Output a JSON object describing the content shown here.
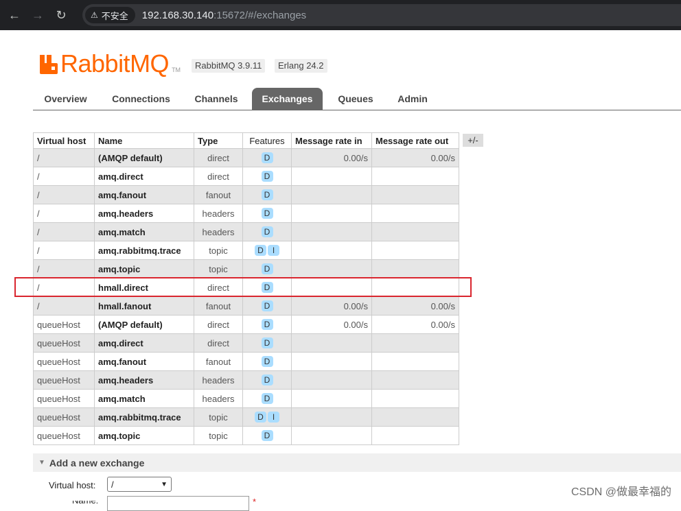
{
  "browser": {
    "security_label": "不安全",
    "url_host": "192.168.30.140",
    "url_rest": ":15672/#/exchanges"
  },
  "header": {
    "logo_text": "RabbitMQ",
    "logo_tm": "TM",
    "version": "RabbitMQ 3.9.11",
    "erlang": "Erlang 24.2",
    "brand_color": "#ff6600"
  },
  "tabs": [
    {
      "label": "Overview"
    },
    {
      "label": "Connections"
    },
    {
      "label": "Channels"
    },
    {
      "label": "Exchanges",
      "active": true
    },
    {
      "label": "Queues"
    },
    {
      "label": "Admin"
    }
  ],
  "table": {
    "columns": [
      "Virtual host",
      "Name",
      "Type",
      "Features",
      "Message rate in",
      "Message rate out"
    ],
    "toggle_label": "+/-",
    "rows": [
      {
        "vhost": "/",
        "name": "(AMQP default)",
        "type": "direct",
        "features": [
          "D"
        ],
        "rate_in": "0.00/s",
        "rate_out": "0.00/s"
      },
      {
        "vhost": "/",
        "name": "amq.direct",
        "type": "direct",
        "features": [
          "D"
        ],
        "rate_in": "",
        "rate_out": ""
      },
      {
        "vhost": "/",
        "name": "amq.fanout",
        "type": "fanout",
        "features": [
          "D"
        ],
        "rate_in": "",
        "rate_out": ""
      },
      {
        "vhost": "/",
        "name": "amq.headers",
        "type": "headers",
        "features": [
          "D"
        ],
        "rate_in": "",
        "rate_out": ""
      },
      {
        "vhost": "/",
        "name": "amq.match",
        "type": "headers",
        "features": [
          "D"
        ],
        "rate_in": "",
        "rate_out": ""
      },
      {
        "vhost": "/",
        "name": "amq.rabbitmq.trace",
        "type": "topic",
        "features": [
          "D",
          "I"
        ],
        "rate_in": "",
        "rate_out": ""
      },
      {
        "vhost": "/",
        "name": "amq.topic",
        "type": "topic",
        "features": [
          "D"
        ],
        "rate_in": "",
        "rate_out": ""
      },
      {
        "vhost": "/",
        "name": "hmall.direct",
        "type": "direct",
        "features": [
          "D"
        ],
        "rate_in": "",
        "rate_out": "",
        "highlighted": true
      },
      {
        "vhost": "/",
        "name": "hmall.fanout",
        "type": "fanout",
        "features": [
          "D"
        ],
        "rate_in": "0.00/s",
        "rate_out": "0.00/s"
      },
      {
        "vhost": "queueHost",
        "name": "(AMQP default)",
        "type": "direct",
        "features": [
          "D"
        ],
        "rate_in": "0.00/s",
        "rate_out": "0.00/s"
      },
      {
        "vhost": "queueHost",
        "name": "amq.direct",
        "type": "direct",
        "features": [
          "D"
        ],
        "rate_in": "",
        "rate_out": ""
      },
      {
        "vhost": "queueHost",
        "name": "amq.fanout",
        "type": "fanout",
        "features": [
          "D"
        ],
        "rate_in": "",
        "rate_out": ""
      },
      {
        "vhost": "queueHost",
        "name": "amq.headers",
        "type": "headers",
        "features": [
          "D"
        ],
        "rate_in": "",
        "rate_out": ""
      },
      {
        "vhost": "queueHost",
        "name": "amq.match",
        "type": "headers",
        "features": [
          "D"
        ],
        "rate_in": "",
        "rate_out": ""
      },
      {
        "vhost": "queueHost",
        "name": "amq.rabbitmq.trace",
        "type": "topic",
        "features": [
          "D",
          "I"
        ],
        "rate_in": "",
        "rate_out": ""
      },
      {
        "vhost": "queueHost",
        "name": "amq.topic",
        "type": "topic",
        "features": [
          "D"
        ],
        "rate_in": "",
        "rate_out": ""
      }
    ]
  },
  "add_exchange": {
    "title": "Add a new exchange",
    "vhost_label": "Virtual host:",
    "vhost_value": "/",
    "name_label": "Name:",
    "required_mark": "*"
  },
  "watermark": "CSDN @做最幸福的"
}
